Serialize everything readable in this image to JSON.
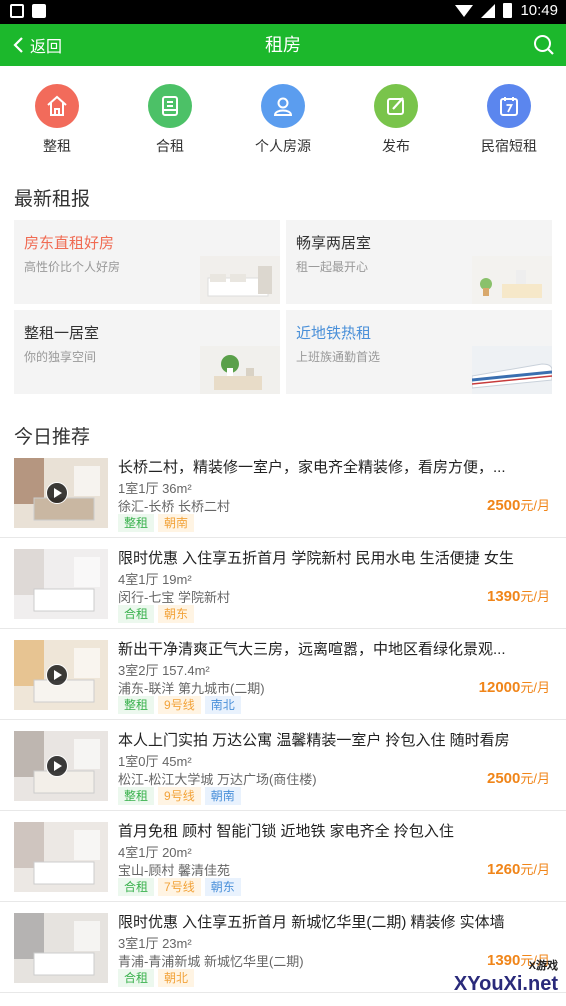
{
  "statusbar": {
    "time": "10:49"
  },
  "navbar": {
    "back_label": "返回",
    "title": "租房"
  },
  "categories": [
    {
      "label": "整租",
      "icon": "house-icon",
      "color": "#f26b5b"
    },
    {
      "label": "合租",
      "icon": "building-icon",
      "color": "#4cc167"
    },
    {
      "label": "个人房源",
      "icon": "person-icon",
      "color": "#5b9def"
    },
    {
      "label": "发布",
      "icon": "edit-icon",
      "color": "#79c44b"
    },
    {
      "label": "民宿短租",
      "icon": "calendar-icon",
      "color": "#5b86ee"
    }
  ],
  "sections": {
    "latest": "最新租报",
    "today": "今日推荐"
  },
  "promos": [
    {
      "title": "房东直租好房",
      "subtitle": "高性价比个人好房",
      "title_color": "#f06b53"
    },
    {
      "title": "畅享两居室",
      "subtitle": "租一起最开心",
      "title_color": "#333333"
    },
    {
      "title": "整租一居室",
      "subtitle": "你的独享空间",
      "title_color": "#333333"
    },
    {
      "title": "近地铁热租",
      "subtitle": "上班族通勤首选",
      "title_color": "#4a90d9"
    }
  ],
  "listings": [
    {
      "title": "长桥二村，精装修一室户，家电齐全精装修，看房方便，...",
      "spec": "1室1厅  36m²",
      "location": "徐汇-长桥  长桥二村",
      "tags": [
        {
          "text": "整租",
          "style": "g"
        },
        {
          "text": "朝南",
          "style": "o"
        }
      ],
      "price": "2500",
      "unit": "元/月",
      "video": true
    },
    {
      "title": "限时优惠 入住享五折首月 学院新村 民用水电 生活便捷 女生",
      "spec": "4室1厅  19m²",
      "location": "闵行-七宝  学院新村",
      "tags": [
        {
          "text": "合租",
          "style": "g"
        },
        {
          "text": "朝东",
          "style": "o"
        }
      ],
      "price": "1390",
      "unit": "元/月",
      "video": false
    },
    {
      "title": "新出干净清爽正气大三房，远离喧嚣，中地区看绿化景观...",
      "spec": "3室2厅  157.4m²",
      "location": "浦东-联洋  第九城市(二期)",
      "tags": [
        {
          "text": "整租",
          "style": "g"
        },
        {
          "text": "9号线",
          "style": "o"
        },
        {
          "text": "南北",
          "style": "b"
        }
      ],
      "price": "12000",
      "unit": "元/月",
      "video": true
    },
    {
      "title": "本人上门实拍 万达公寓 温馨精装一室户 拎包入住 随时看房",
      "spec": "1室0厅  45m²",
      "location": "松江-松江大学城  万达广场(商住楼)",
      "tags": [
        {
          "text": "整租",
          "style": "g"
        },
        {
          "text": "9号线",
          "style": "o"
        },
        {
          "text": "朝南",
          "style": "b"
        }
      ],
      "price": "2500",
      "unit": "元/月",
      "video": true
    },
    {
      "title": "首月免租 顾村 智能门锁 近地铁 家电齐全 拎包入住",
      "spec": "4室1厅  20m²",
      "location": "宝山-顾村  馨清佳苑",
      "tags": [
        {
          "text": "合租",
          "style": "g"
        },
        {
          "text": "7号线",
          "style": "o"
        },
        {
          "text": "朝东",
          "style": "b"
        }
      ],
      "price": "1260",
      "unit": "元/月",
      "video": false
    },
    {
      "title": "限时优惠 入住享五折首月 新城忆华里(二期) 精装修 实体墙",
      "spec": "3室1厅  23m²",
      "location": "青浦-青浦新城  新城忆华里(二期)",
      "tags": [
        {
          "text": "合租",
          "style": "g"
        },
        {
          "text": "朝北",
          "style": "o"
        }
      ],
      "price": "1390",
      "unit": "元/月",
      "video": false
    }
  ],
  "watermark": {
    "small": "X游戏",
    "main": "XYouXi.net"
  }
}
